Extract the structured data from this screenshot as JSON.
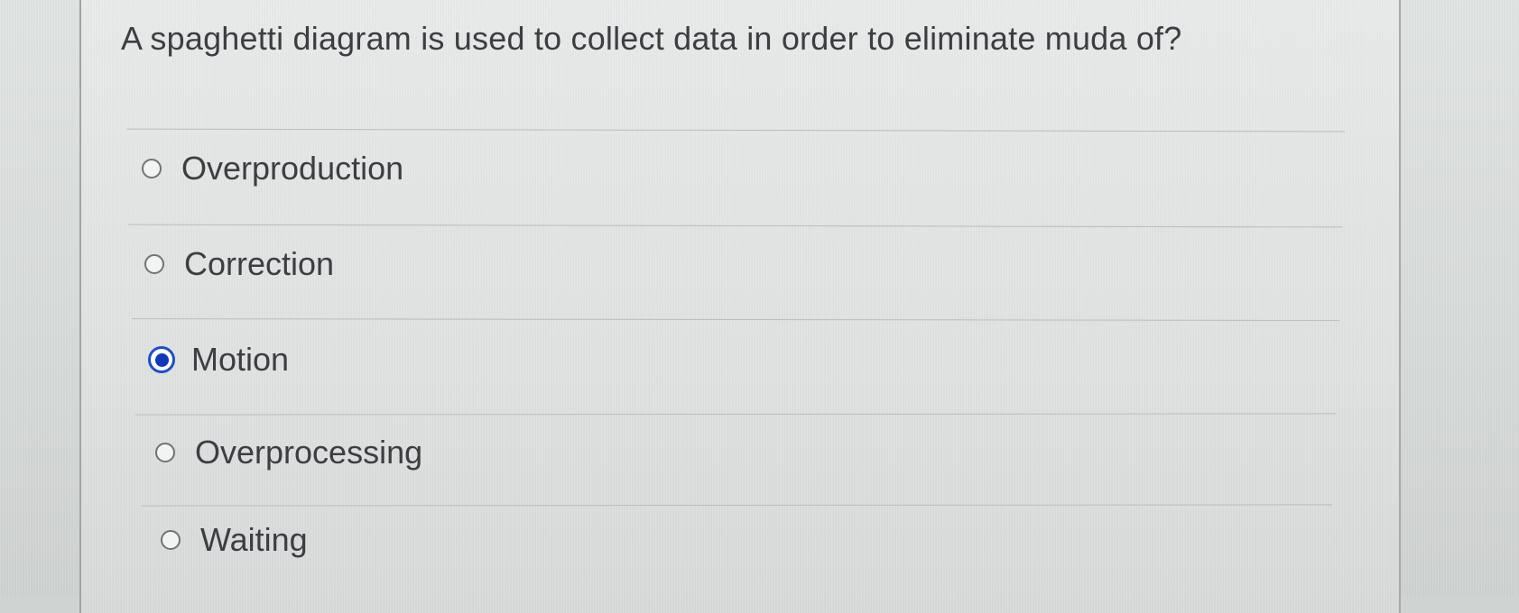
{
  "question": "A spaghetti diagram is used to collect data in order to eliminate muda of?",
  "options": [
    {
      "label": "Overproduction",
      "selected": false
    },
    {
      "label": "Correction",
      "selected": false
    },
    {
      "label": "Motion",
      "selected": true
    },
    {
      "label": "Overprocessing",
      "selected": false
    },
    {
      "label": "Waiting",
      "selected": false
    }
  ],
  "colors": {
    "selected_radio": "#1f4fc6",
    "text": "#3b3f42"
  },
  "icons": {
    "unselected": "radio-unselected-icon",
    "selected": "radio-selected-icon"
  }
}
